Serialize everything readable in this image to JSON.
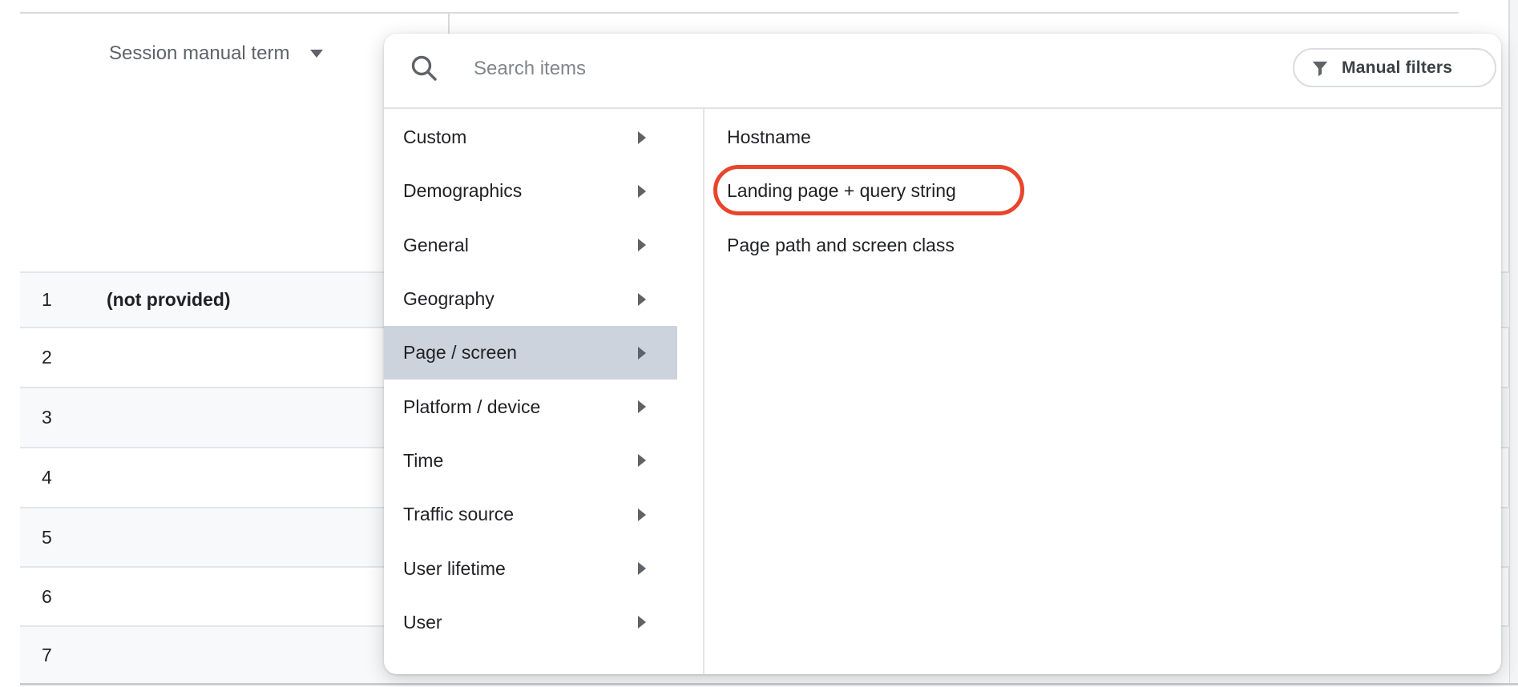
{
  "background": {
    "dimension_header": {
      "label": "Session manual term"
    },
    "table": {
      "rows": [
        {
          "index": "1",
          "value": "(not provided)"
        },
        {
          "index": "2",
          "value": ""
        },
        {
          "index": "3",
          "value": ""
        },
        {
          "index": "4",
          "value": ""
        },
        {
          "index": "5",
          "value": ""
        },
        {
          "index": "6",
          "value": ""
        },
        {
          "index": "7",
          "value": ""
        }
      ]
    }
  },
  "dropdown": {
    "search": {
      "placeholder": "Search items"
    },
    "manual_filters": {
      "label": "Manual filters"
    },
    "categories": [
      {
        "label": "Custom",
        "selected": false
      },
      {
        "label": "Demographics",
        "selected": false
      },
      {
        "label": "General",
        "selected": false
      },
      {
        "label": "Geography",
        "selected": false
      },
      {
        "label": "Page / screen",
        "selected": true
      },
      {
        "label": "Platform / device",
        "selected": false
      },
      {
        "label": "Time",
        "selected": false
      },
      {
        "label": "Traffic source",
        "selected": false
      },
      {
        "label": "User lifetime",
        "selected": false
      },
      {
        "label": "User",
        "selected": false
      }
    ],
    "items": [
      {
        "label": "Hostname",
        "annotated": false
      },
      {
        "label": "Landing page + query string",
        "annotated": true
      },
      {
        "label": "Page path and screen class",
        "annotated": false
      }
    ]
  },
  "colors": {
    "selected_category_bg": "#cdd3dd",
    "annotation_ring": "#e8452c",
    "icon_gray": "#5f6368",
    "text_dark": "#202124",
    "text_gray": "#5f6368",
    "placeholder_gray": "#80868b",
    "divider_gray": "#dadce0",
    "row_shade": "#f8f9fa"
  }
}
